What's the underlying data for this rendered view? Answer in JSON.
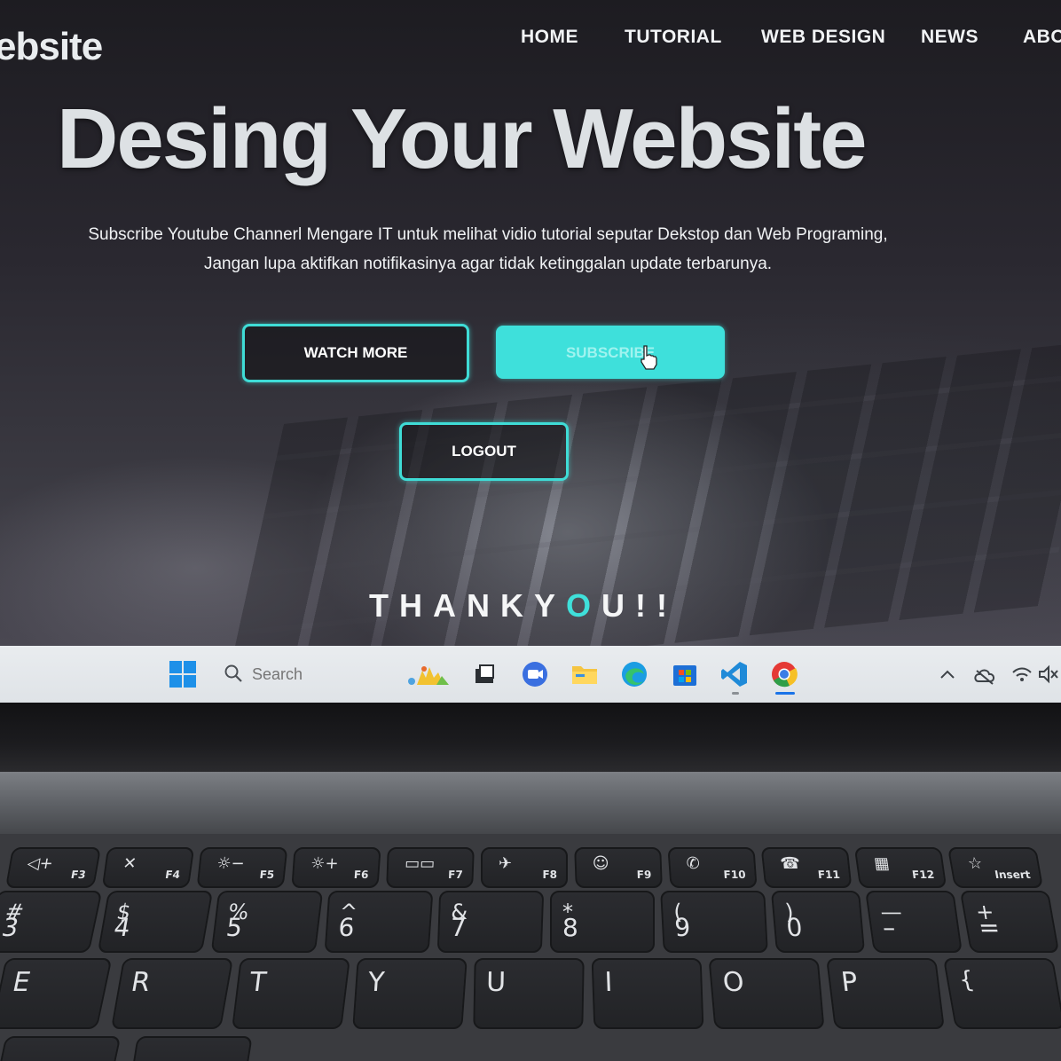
{
  "site": {
    "brand": "ebsite",
    "nav": [
      "HOME",
      "TUTORIAL",
      "WEB DESIGN",
      "NEWS",
      "ABO"
    ],
    "hero_title": "Desing Your Website",
    "hero_text_line1": "Subscribe Youtube Channerl Mengare IT untuk melihat vidio tutorial seputar Dekstop dan Web Programing,",
    "hero_text_line2": "Jangan lupa aktifkan notifikasinya agar tidak ketinggalan update terbarunya.",
    "buttons": {
      "watch_more": "WATCH MORE",
      "subscribe": "SUBSCRIBE",
      "logout": "LOGOUT"
    },
    "thanks_pre": "THANKY",
    "thanks_o": "O",
    "thanks_post": "U!!",
    "accent": "#3fdcd6"
  },
  "taskbar": {
    "search_placeholder": "Search",
    "apps": [
      "start-icon",
      "widgets-icon",
      "task-view-icon",
      "meet-icon",
      "file-explorer-icon",
      "edge-icon",
      "store-icon",
      "vscode-icon",
      "chrome-icon"
    ],
    "tray": [
      "chevron-up-icon",
      "cloud-icon",
      "wifi-icon",
      "volume-mute-icon"
    ]
  },
  "keyboard": {
    "fn_row": [
      {
        "sym": "◁+",
        "fn": "F3"
      },
      {
        "sym": "✕",
        "fn": "F4"
      },
      {
        "sym": "☼−",
        "fn": "F5"
      },
      {
        "sym": "☼+",
        "fn": "F6"
      },
      {
        "sym": "▭▭",
        "fn": "F7"
      },
      {
        "sym": "✈",
        "fn": "F8"
      },
      {
        "sym": "☺",
        "fn": "F9"
      },
      {
        "sym": "✆",
        "fn": "F10"
      },
      {
        "sym": "☎",
        "fn": "F11"
      },
      {
        "sym": "▦",
        "fn": "F12"
      },
      {
        "sym": "☆",
        "fn": "Insert"
      }
    ],
    "num_row": [
      {
        "top": "#",
        "main": "3"
      },
      {
        "top": "$",
        "main": "4"
      },
      {
        "top": "%",
        "main": "5"
      },
      {
        "top": "^",
        "main": "6"
      },
      {
        "top": "&",
        "main": "7"
      },
      {
        "top": "*",
        "main": "8"
      },
      {
        "top": "(",
        "main": "9"
      },
      {
        "top": ")",
        "main": "0"
      },
      {
        "top": "—",
        "main": "–"
      },
      {
        "top": "+",
        "main": "="
      }
    ],
    "letter_row": [
      "E",
      "R",
      "T",
      "Y",
      "U",
      "I",
      "O",
      "P",
      "{"
    ]
  }
}
